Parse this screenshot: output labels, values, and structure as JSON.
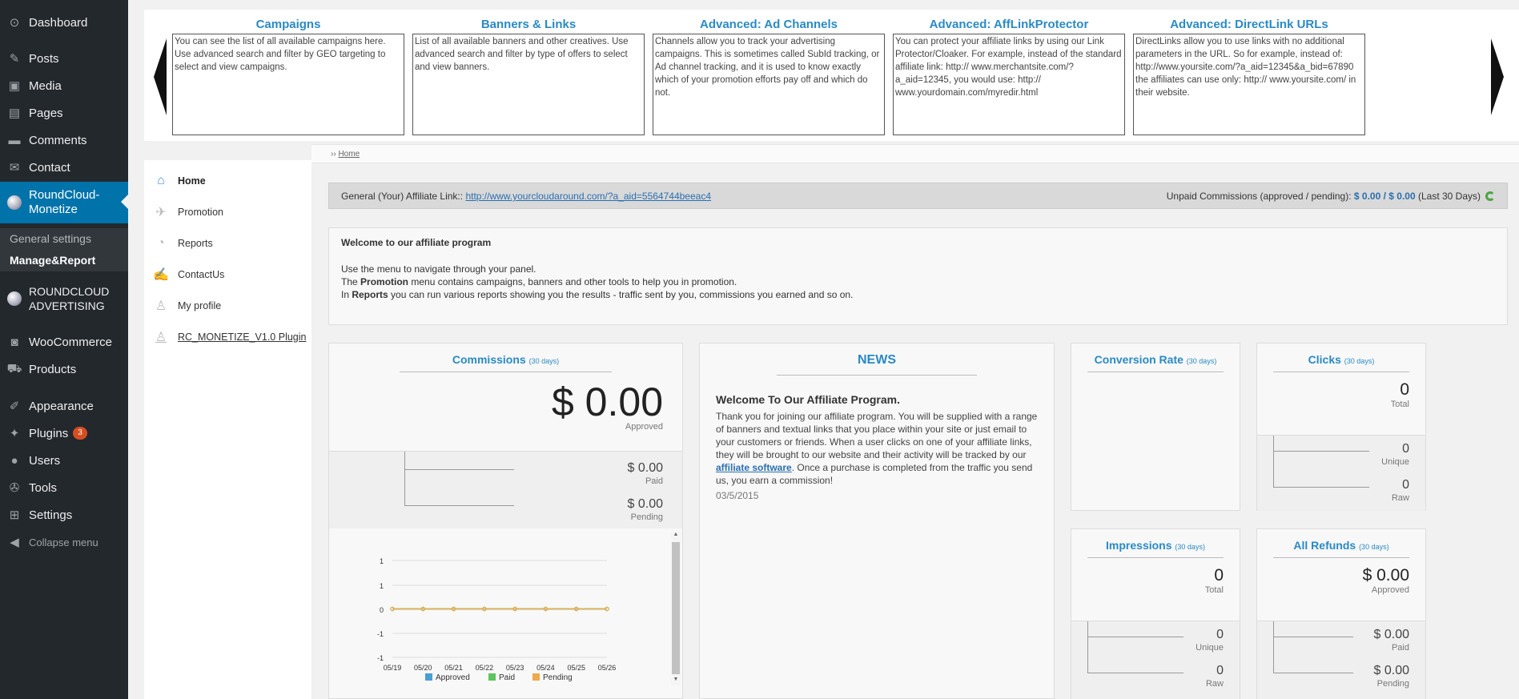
{
  "sidebar": {
    "items": [
      {
        "icon": "dashboard-icon",
        "glyph": "⊙",
        "label": "Dashboard"
      },
      {
        "icon": "posts-icon",
        "glyph": "✎",
        "label": "Posts"
      },
      {
        "icon": "media-icon",
        "glyph": "▣",
        "label": "Media"
      },
      {
        "icon": "pages-icon",
        "glyph": "▤",
        "label": "Pages"
      },
      {
        "icon": "comments-icon",
        "glyph": "▬",
        "label": "Comments"
      },
      {
        "icon": "contact-icon",
        "glyph": "✉",
        "label": "Contact"
      },
      {
        "icon": "roundcloud-icon",
        "glyph": "",
        "label": "RoundCloud-Monetize"
      },
      {
        "icon": "roundcloud-advertising-icon",
        "glyph": "",
        "label": "ROUNDCLOUD ADVERTISING"
      },
      {
        "icon": "woocommerce-icon",
        "glyph": "◙",
        "label": "WooCommerce"
      },
      {
        "icon": "products-icon",
        "glyph": "⛟",
        "label": "Products"
      },
      {
        "icon": "appearance-icon",
        "glyph": "✐",
        "label": "Appearance"
      },
      {
        "icon": "plugins-icon",
        "glyph": "✦",
        "label": "Plugins",
        "badge": "3"
      },
      {
        "icon": "users-icon",
        "glyph": "●",
        "label": "Users"
      },
      {
        "icon": "tools-icon",
        "glyph": "✇",
        "label": "Tools"
      },
      {
        "icon": "settings-icon",
        "glyph": "⊞",
        "label": "Settings"
      },
      {
        "icon": "collapse-icon",
        "glyph": "◀",
        "label": "Collapse menu"
      }
    ],
    "submenu": [
      "General settings",
      "Manage&Report"
    ]
  },
  "tips": [
    {
      "title": "Campaigns",
      "text": "You can see the list of all available campaigns here. Use advanced search and filter by GEO targeting to select and view campaigns."
    },
    {
      "title": "Banners & Links",
      "text": "List of all available banners and other creatives. Use advanced search and filter by type of offers to select and view banners."
    },
    {
      "title": "Advanced: Ad Channels",
      "text": "Channels allow you to track your advertising campaigns. This is sometimes called SubId tracking, or Ad channel tracking, and it is used to know exactly which of your promotion efforts pay off and which do not."
    },
    {
      "title": "Advanced: AffLinkProtector",
      "text": "You can protect your affiliate links by using our Link Protector/Cloaker. For example, instead of the standard affiliate link: http:// www.merchantsite.com/?a_aid=12345, you would use: http:// www.yourdomain.com/myredir.html"
    },
    {
      "title": "Advanced: DirectLink URLs",
      "text": "DirectLinks allow you to use links with no additional parameters in the URL. So for example, instead of: http://www.yoursite.com/?a_aid=12345&a_bid=67890 the affiliates can use only: http:// www.yoursite.com/ in their website."
    }
  ],
  "breadcrumb": {
    "sep": "››",
    "home": "Home"
  },
  "menu": [
    {
      "icon": "home-icon",
      "glyph": "⌂",
      "label": "Home"
    },
    {
      "icon": "promotion-icon",
      "glyph": "✈",
      "label": "Promotion"
    },
    {
      "icon": "reports-icon",
      "glyph": "◔",
      "label": "Reports"
    },
    {
      "icon": "contactus-icon",
      "glyph": "✍",
      "label": "ContactUs"
    },
    {
      "icon": "profile-icon",
      "glyph": "♙",
      "label": "My profile"
    },
    {
      "icon": "plugin-icon",
      "glyph": "♙",
      "label": "RC_MONETIZE_V1.0 Plugin"
    }
  ],
  "affiliate": {
    "label": "General (Your) Affiliate Link::",
    "link": "http://www.yourcloudaround.com/?a_aid=5564744beeac4",
    "unpaid_label": "Unpaid Commissions (approved / pending):",
    "unpaid_value": "$ 0.00 / $ 0.00",
    "period": "(Last 30 Days)"
  },
  "welcome": {
    "title": "Welcome to our affiliate program",
    "line1": "Use the menu to navigate through your panel.",
    "line2a": "The ",
    "line2b": "Promotion",
    "line2c": " menu contains campaigns, banners and other tools to help you in promotion.",
    "line3a": "In ",
    "line3b": "Reports",
    "line3c": " you can run various reports showing you the results - traffic sent by you, commissions you earned and so on."
  },
  "commissions": {
    "title": "Commissions",
    "period": "(30 days)",
    "approved_value": "$ 0.00",
    "approved_label": "Approved",
    "paid_value": "$ 0.00",
    "paid_label": "Paid",
    "pending_value": "$ 0.00",
    "pending_label": "Pending"
  },
  "news": {
    "title": "NEWS",
    "headline": "Welcome To Our Affiliate Program.",
    "body1": "Thank you for joining our affiliate program. You will be supplied with a range of banners and textual links that you place within your site or just email to your customers or friends. When a user clicks on one of your affiliate links, they will be brought to our website and their activity will be tracked by our ",
    "link": "affiliate software",
    "body2": ". Once a purchase is completed from the traffic you send us, you earn a commission!",
    "date": "03/5/2015"
  },
  "conversion": {
    "title": "Conversion Rate",
    "period": "(30 days)"
  },
  "clicks": {
    "title": "Clicks",
    "period": "(30 days)",
    "total": "0",
    "total_label": "Total",
    "unique": "0",
    "unique_label": "Unique",
    "raw": "0",
    "raw_label": "Raw"
  },
  "impressions": {
    "title": "Impressions",
    "period": "(30 days)",
    "total": "0",
    "total_label": "Total",
    "unique": "0",
    "unique_label": "Unique",
    "raw": "0",
    "raw_label": "Raw"
  },
  "refunds": {
    "title": "All Refunds",
    "period": "(30 days)",
    "approved": "$ 0.00",
    "approved_label": "Approved",
    "paid": "$ 0.00",
    "paid_label": "Paid",
    "pending": "$ 0.00",
    "pending_label": "Pending"
  },
  "chart_data": {
    "type": "line",
    "x": [
      "05/19",
      "05/20",
      "05/21",
      "05/22",
      "05/23",
      "05/24",
      "05/25",
      "05/26"
    ],
    "y_ticks": [
      "1",
      "1",
      "0",
      "-1",
      "-1"
    ],
    "ylim": [
      -1,
      1
    ],
    "series": [
      {
        "name": "Approved",
        "color": "#4a9fd5",
        "values": [
          0,
          0,
          0,
          0,
          0,
          0,
          0,
          0
        ]
      },
      {
        "name": "Paid",
        "color": "#5cc55c",
        "values": [
          0,
          0,
          0,
          0,
          0,
          0,
          0,
          0
        ]
      },
      {
        "name": "Pending",
        "color": "#f0a94b",
        "values": [
          0,
          0,
          0,
          0,
          0,
          0,
          0,
          0
        ]
      }
    ],
    "grid": true,
    "legend": "bottom"
  }
}
